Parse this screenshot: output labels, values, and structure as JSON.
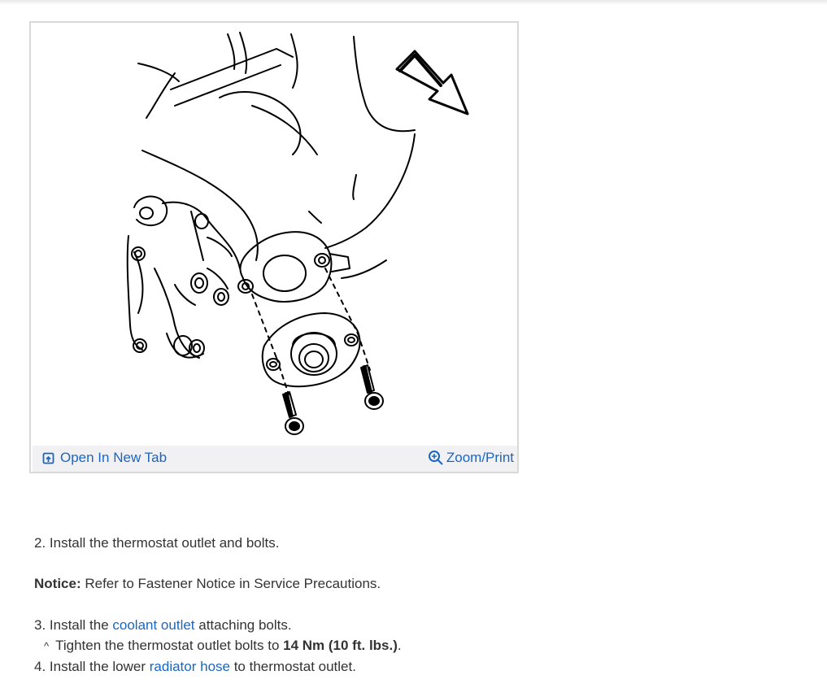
{
  "figure": {
    "open_tab_label": "Open In New Tab",
    "zoom_print_label": "Zoom/Print"
  },
  "steps": {
    "step2": "2. Install the thermostat outlet and bolts.",
    "notice_label": "Notice:",
    "notice_text": " Refer to Fastener Notice in Service Precautions.",
    "step3_prefix": "3. Install the ",
    "step3_link": "coolant outlet",
    "step3_suffix": " attaching bolts.",
    "sub_caret": "^",
    "sub_prefix": "Tighten the thermostat outlet bolts to ",
    "sub_torque": "14 Nm (10 ft. lbs.)",
    "sub_suffix": ".",
    "step4_prefix": "4. Install the lower ",
    "step4_link": "radiator hose",
    "step4_suffix": " to thermostat outlet."
  },
  "colors": {
    "link": "#1a66c0",
    "text": "#333333",
    "toolbar_bg": "#f1f1f4"
  }
}
